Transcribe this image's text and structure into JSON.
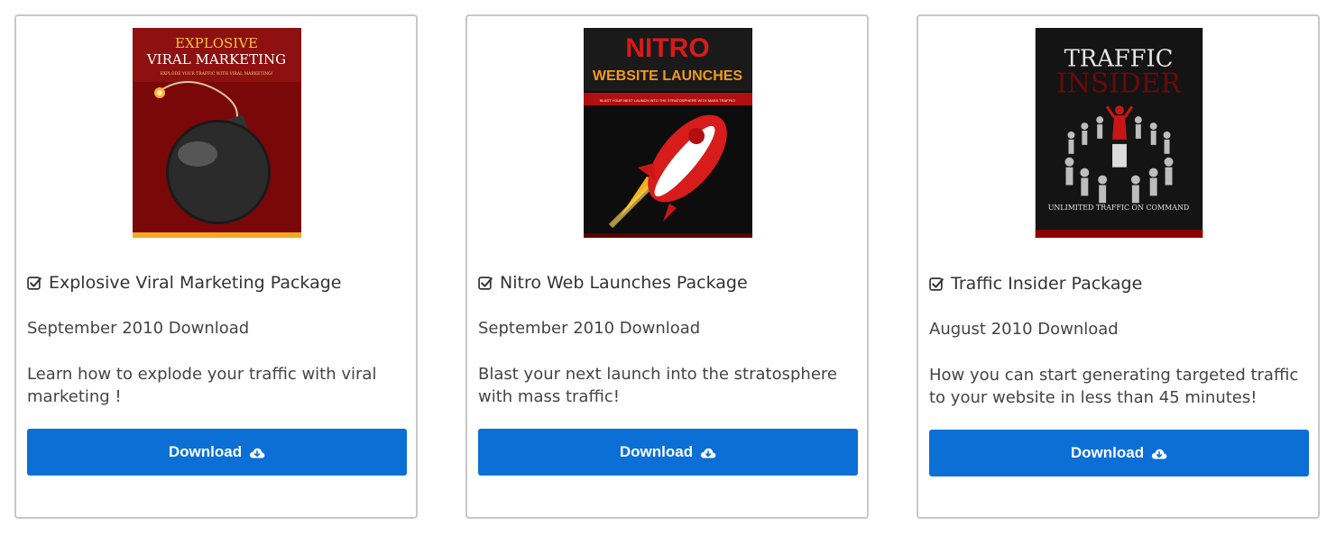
{
  "products": [
    {
      "cover": {
        "line1": "EXPLOSIVE",
        "line2": "VIRAL MARKETING",
        "tagline": "EXPLODE YOUR TRAFFIC WITH VIRAL MARKETING!",
        "bg": "#8a0a0a",
        "accent": "#f5a623"
      },
      "title": "Explosive Viral Marketing Package",
      "date": "September 2010 Download",
      "description": "Learn how to explode your traffic with viral marketing !",
      "button_label": "Download"
    },
    {
      "cover": {
        "line1": "NITRO",
        "line2": "WEBSITE LAUNCHES",
        "tagline": "BLAST YOUR NEXT LAUNCH INTO THE STRATOSPHERE WITH MASS TRAFFIC!",
        "bg": "#111111",
        "accent": "#d91a1a"
      },
      "title": "Nitro Web Launches Package",
      "date": "September 2010 Download",
      "description": "Blast your next launch into the stratosphere with mass traffic!",
      "button_label": "Download"
    },
    {
      "cover": {
        "line1": "TRAFFIC",
        "line2": "INSIDER",
        "tagline": "UNLIMITED TRAFFIC ON COMMAND",
        "bg": "#151515",
        "accent": "#8b0000"
      },
      "title": "Traffic Insider Package",
      "date": "August 2010 Download",
      "description": "How you can start generating targeted traffic to your website in less than 45 minutes!",
      "button_label": "Download"
    }
  ],
  "icons": {
    "title_icon": "check-square-icon",
    "button_icon": "cloud-download-icon"
  },
  "colors": {
    "button": "#0b6fd6",
    "border": "#c8c8c8"
  }
}
